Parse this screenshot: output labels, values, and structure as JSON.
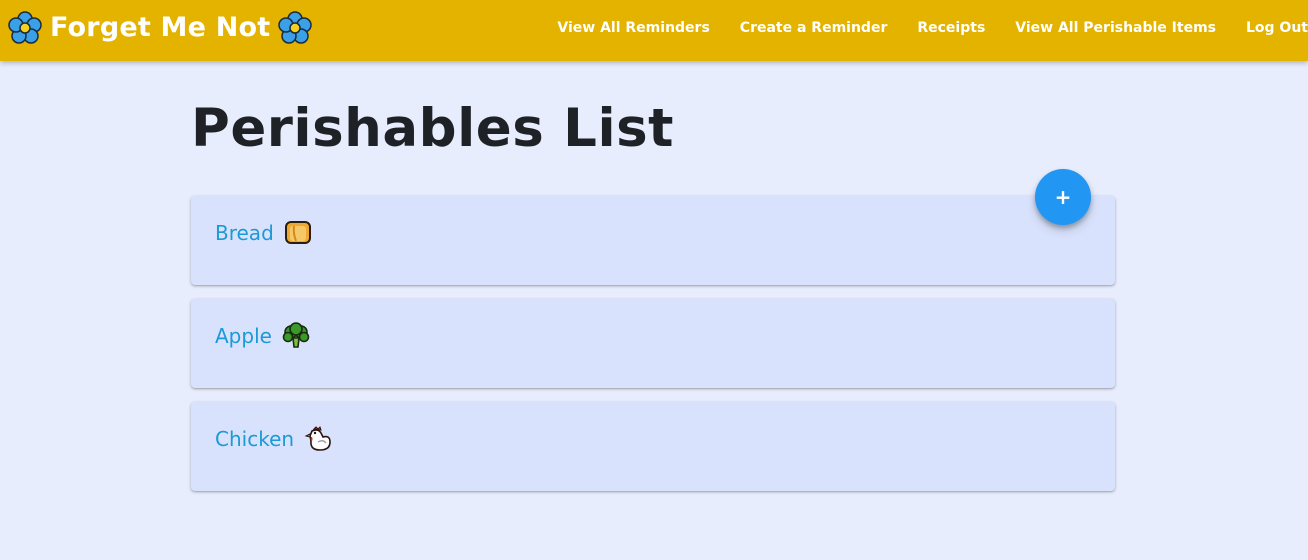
{
  "app": {
    "title": "Forget Me Not",
    "brand_icon": "forget-me-not-flower-icon"
  },
  "nav": {
    "links": [
      {
        "label": "View All Reminders"
      },
      {
        "label": "Create a Reminder"
      },
      {
        "label": "Receipts"
      },
      {
        "label": "View All Perishable Items"
      },
      {
        "label": "Log Out"
      }
    ]
  },
  "page": {
    "title": "Perishables List",
    "add_button_label": "+"
  },
  "items": [
    {
      "name": "Bread",
      "icon": "bread-icon"
    },
    {
      "name": "Apple",
      "icon": "broccoli-icon"
    },
    {
      "name": "Chicken",
      "icon": "chicken-icon"
    }
  ],
  "colors": {
    "navbar": "#e3b300",
    "background": "#e8edfd",
    "card": "#d9e2fd",
    "item_text": "#1a9ad6",
    "fab": "#2196f3"
  }
}
